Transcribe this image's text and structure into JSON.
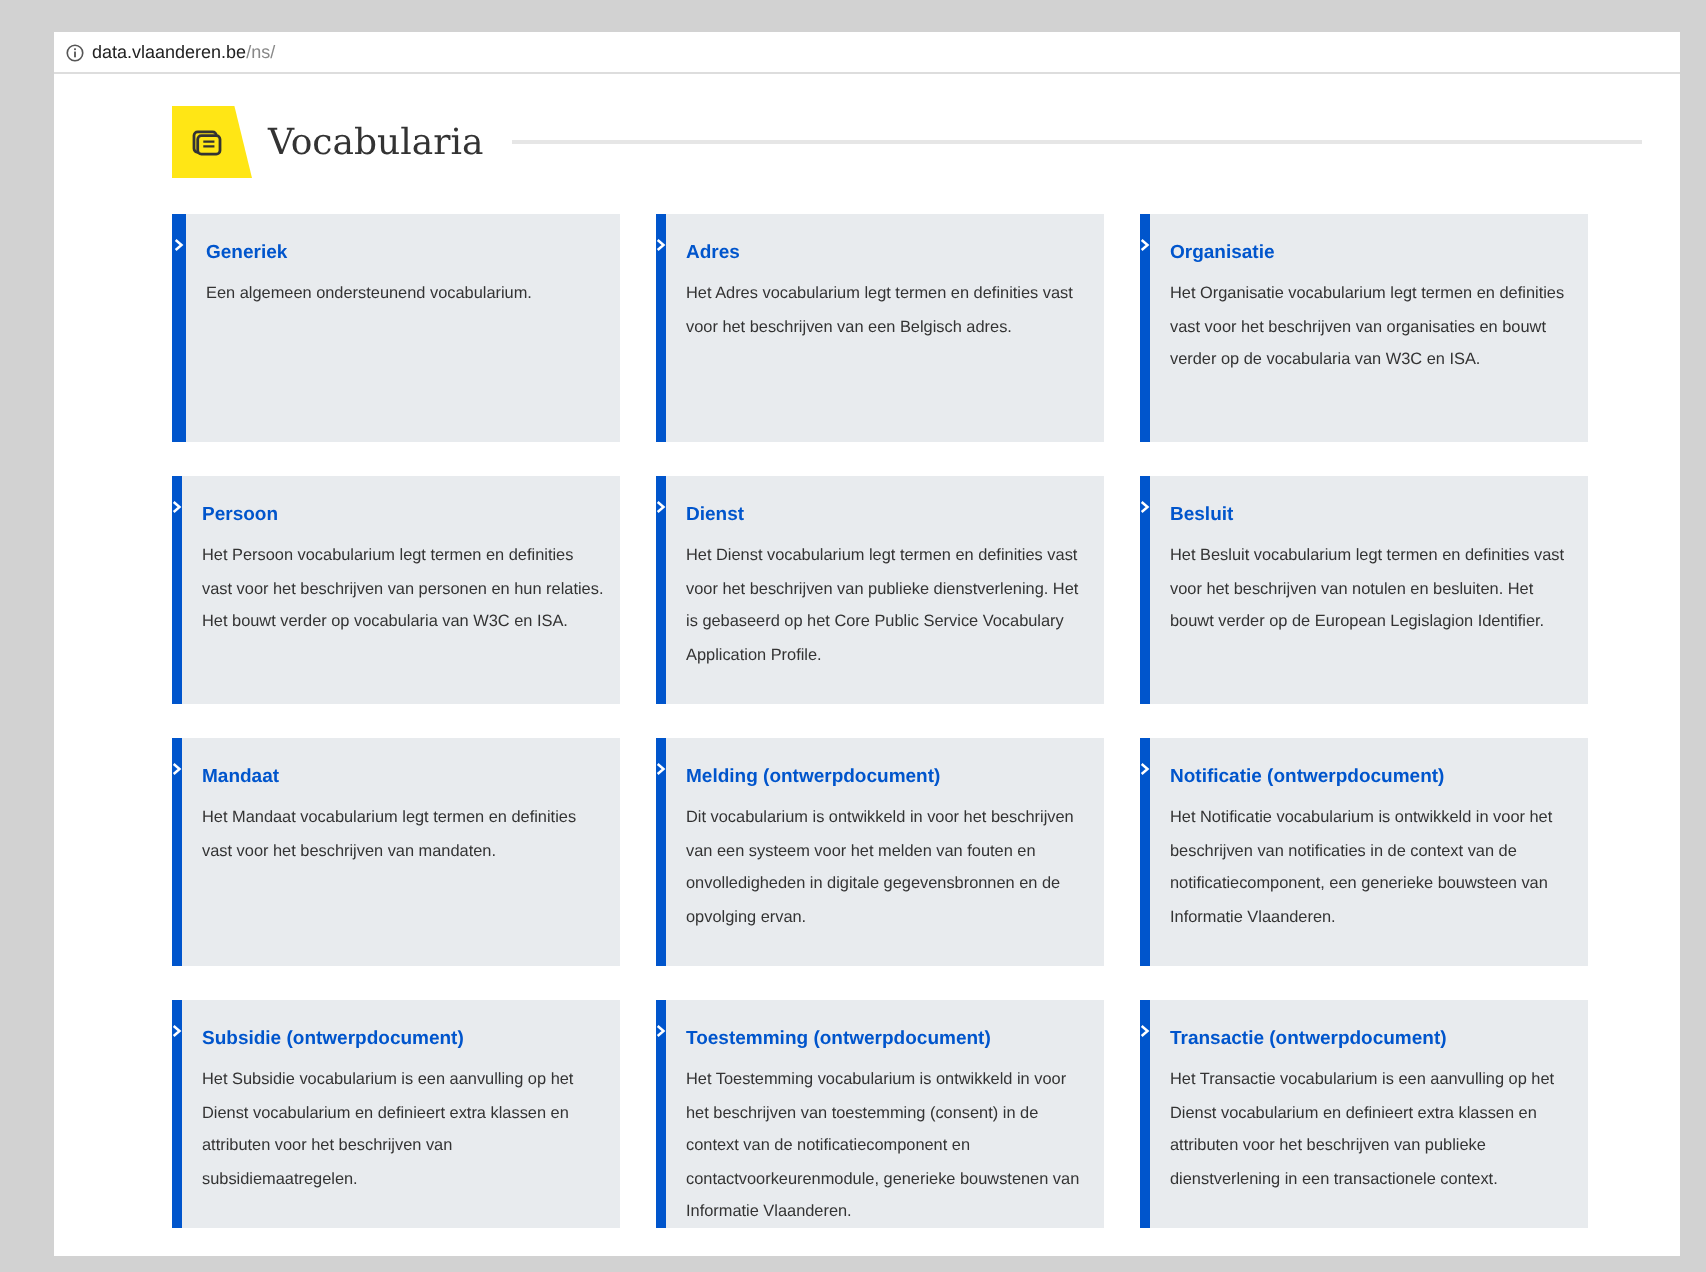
{
  "address_bar": {
    "host": "data.vlaanderen.be",
    "path": "/ns/"
  },
  "heading": {
    "title": "Vocabularia"
  },
  "cards": [
    {
      "title": "Generiek",
      "description": "Een algemeen ondersteunend vocabularium."
    },
    {
      "title": "Adres",
      "description": "Het Adres vocabularium legt termen en definities vast voor het beschrijven van een Belgisch adres."
    },
    {
      "title": "Organisatie",
      "description": "Het Organisatie vocabularium legt termen en definities vast voor het beschrijven van organisaties en bouwt verder op de vocabularia van W3C en ISA."
    },
    {
      "title": "Persoon",
      "description": "Het Persoon vocabularium legt termen en definities vast voor het beschrijven van personen en hun relaties. Het bouwt verder op vocabularia van W3C en ISA."
    },
    {
      "title": "Dienst",
      "description": "Het Dienst vocabularium legt termen en definities vast voor het beschrijven van publieke dienstverlening. Het is gebaseerd op het Core Public Service Vocabulary Application Profile."
    },
    {
      "title": "Besluit",
      "description": "Het Besluit vocabularium legt termen en definities vast voor het beschrijven van notulen en besluiten. Het bouwt verder op de European Legislagion Identifier."
    },
    {
      "title": "Mandaat",
      "description": "Het Mandaat vocabularium legt termen en definities vast voor het beschrijven van mandaten."
    },
    {
      "title": "Melding (ontwerpdocument)",
      "description": "Dit vocabularium is ontwikkeld in voor het beschrijven van een systeem voor het melden van fouten en onvolledigheden in digitale gegevensbronnen en de opvolging ervan."
    },
    {
      "title": "Notificatie (ontwerpdocument)",
      "description": "Het Notificatie vocabularium is ontwikkeld in voor het beschrijven van notificaties in de context van de notificatiecomponent, een generieke bouwsteen van Informatie Vlaanderen."
    },
    {
      "title": "Subsidie (ontwerpdocument)",
      "description": "Het Subsidie vocabularium is een aanvulling op het Dienst vocabularium en definieert extra klassen en attributen voor het beschrijven van subsidiemaatregelen."
    },
    {
      "title": "Toestemming (ontwerpdocument)",
      "description": "Het Toestemming vocabularium is ontwikkeld in voor het beschrijven van toestemming (consent) in de context van de notificatiecomponent en contactvoorkeurenmodule, generieke bouwstenen van Informatie Vlaanderen."
    },
    {
      "title": "Transactie (ontwerpdocument)",
      "description": "Het Transactie vocabularium is een aanvulling op het Dienst vocabularium en definieert extra klassen en attributen voor het beschrijven van publieke dienstverlening in een transactionele context."
    }
  ]
}
